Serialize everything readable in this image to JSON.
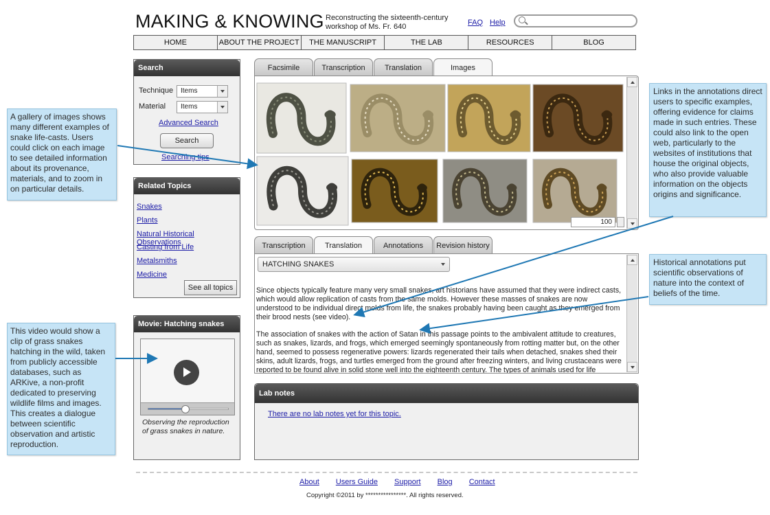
{
  "header": {
    "title": "MAKING & KNOWING",
    "subtitle": "Reconstructing the sixteenth-century workshop of Ms. Fr. 640",
    "faq": "FAQ",
    "help": "Help",
    "search_placeholder": ""
  },
  "nav": [
    "HOME",
    "ABOUT THE PROJECT",
    "THE MANUSCRIPT",
    "THE LAB",
    "RESOURCES",
    "BLOG"
  ],
  "search_panel": {
    "title": "Search",
    "technique_label": "Technique",
    "technique_value": "Items",
    "material_label": "Material",
    "material_value": "Items",
    "advanced": "Advanced Search",
    "button": "Search",
    "tips": "Searching tips"
  },
  "related": {
    "title": "Related Topics",
    "items": [
      "Snakes",
      "Plants",
      "Natural Historical Observations",
      "Casting from Life",
      "Metalsmiths",
      "Medicine"
    ],
    "see_all": "See all topics"
  },
  "movie": {
    "title": "Movie: Hatching snakes",
    "progress": 0.46,
    "caption": "Observing the reproduction of grass snakes in nature."
  },
  "image_tabs": {
    "labels": [
      "Facsimile",
      "Transcription",
      "Translation",
      "Images"
    ],
    "active": 3
  },
  "images": {
    "thumbnails": [
      "snake-coil-dark",
      "snake-silver-relief",
      "snake-gold-dish",
      "snake-round-platter",
      "snake-silver-curl",
      "snake-gold-cluster",
      "snake-silver-bronze",
      "snake-bronze-pair"
    ],
    "zoom": "100"
  },
  "text_tabs": {
    "labels": [
      "Transcription",
      "Translation",
      "Annotations",
      "Revision history"
    ],
    "active": 1
  },
  "text": {
    "topic": "HATCHING SNAKES",
    "para1": "Since objects typically feature many very small snakes, art historians have assumed that they were indirect casts, which would allow replication of casts from the same molds. However these masses of snakes are now understood to be individual direct molds from life, the snakes probably having been caught as they emerged from their brood nests (see video).",
    "para2": "The association of snakes with the action of Satan in this passage points to the ambivalent attitude to creatures, such as snakes, lizards, and frogs, which emerged seemingly spontaneously from rotting matter but, on the other hand, seemed to possess regenerative powers: lizards regenerated their tails when detached, snakes shed their skins, adult lizards, frogs, and turtles emerged from the ground after freezing winters, and living crustaceans were reported to be found alive in solid stone well into the eighteenth century.  The types of animals used for life"
  },
  "lab": {
    "title": "Lab notes",
    "note": "There are no lab notes yet for this topic."
  },
  "callouts": {
    "gallery": "A gallery of images shows many different examples of snake life-casts. Users could click on each image to see detailed information about its provenance, materials, and to zoom in on particular details.",
    "video": "This video would show a clip of grass snakes hatching in the wild, taken from publicly accessible databases, such as ARKive, a non-profit dedicated to preserving wildlife films and images. This creates a dialogue between scientific observation and artistic reproduction.",
    "links": "Links in the annotations direct users to specific examples, offering evidence for claims made in such entries. These could also link to the open web, particularly to the websites of institutions that house the original objects, who also provide valuable information on the objects origins and significance.",
    "annotations": "Historical annotations put scientific observations of nature into the context of beliefs of the time."
  },
  "footer": {
    "links": [
      "About",
      "Users Guide",
      "Support",
      "Blog",
      "Contact"
    ],
    "copyright": "Copyright ©2011 by ****************. All rights reserved."
  },
  "colors": {
    "callout": "#c6e4f6",
    "arrow": "#1f78b4",
    "panel_head": "#3d3d3d",
    "link": "#1a1aa6"
  }
}
